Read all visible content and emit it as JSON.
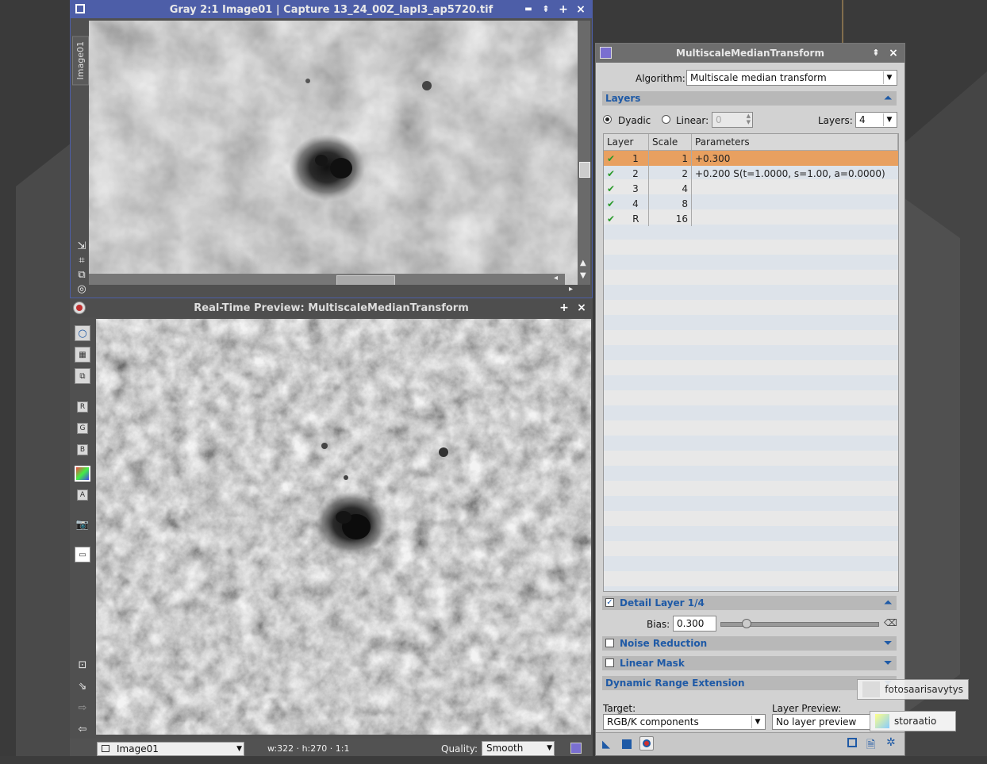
{
  "image_window": {
    "title": "Gray 2:1 Image01 | Capture 13_24_00Z_lapl3_ap5720.tif",
    "tab_label": "Image01",
    "buttons": {
      "shade": "▬",
      "minimize": "⇞",
      "maximize": "+",
      "close": "×"
    }
  },
  "preview_window": {
    "title": "Real-Time Preview: MultiscaleMedianTransform",
    "buttons": {
      "maximize": "+",
      "close": "×"
    },
    "status": {
      "view_name": "Image01",
      "dimensions": "w:322 · h:270 · 1:1",
      "quality_label": "Quality:",
      "quality_value": "Smooth"
    }
  },
  "mmt_panel": {
    "title": "MultiscaleMedianTransform",
    "algorithm_label": "Algorithm:",
    "algorithm_value": "Multiscale median transform",
    "layers_section": "Layers",
    "dyadic_label": "Dyadic",
    "linear_label": "Linear:",
    "linear_value": "0",
    "layers_label": "Layers:",
    "layers_value": "4",
    "table": {
      "headers": [
        "Layer",
        "Scale",
        "Parameters"
      ],
      "rows": [
        {
          "layer": "1",
          "scale": "1",
          "params": "+0.300",
          "selected": true
        },
        {
          "layer": "2",
          "scale": "2",
          "params": "+0.200 S(t=1.0000, s=1.00, a=0.0000)",
          "selected": false
        },
        {
          "layer": "3",
          "scale": "4",
          "params": "",
          "selected": false
        },
        {
          "layer": "4",
          "scale": "8",
          "params": "",
          "selected": false
        },
        {
          "layer": "R",
          "scale": "16",
          "params": "",
          "selected": false
        }
      ]
    },
    "detail_layer_section": "Detail Layer 1/4",
    "bias_label": "Bias:",
    "bias_value": "0.300",
    "bias_fraction": 0.13,
    "noise_reduction_section": "Noise Reduction",
    "linear_mask_section": "Linear Mask",
    "dre_section": "Dynamic Range Extension",
    "target_label": "Target:",
    "target_value": "RGB/K components",
    "layer_preview_label": "Layer Preview:",
    "layer_preview_value": "No layer preview"
  },
  "notifications": [
    {
      "text": "fotosaarisavytys"
    },
    {
      "text": "storaatio"
    }
  ],
  "colors": {
    "selected_row": "#e8a060",
    "section_header_text": "#1f5aa6",
    "check_green": "#2a9a2a"
  }
}
